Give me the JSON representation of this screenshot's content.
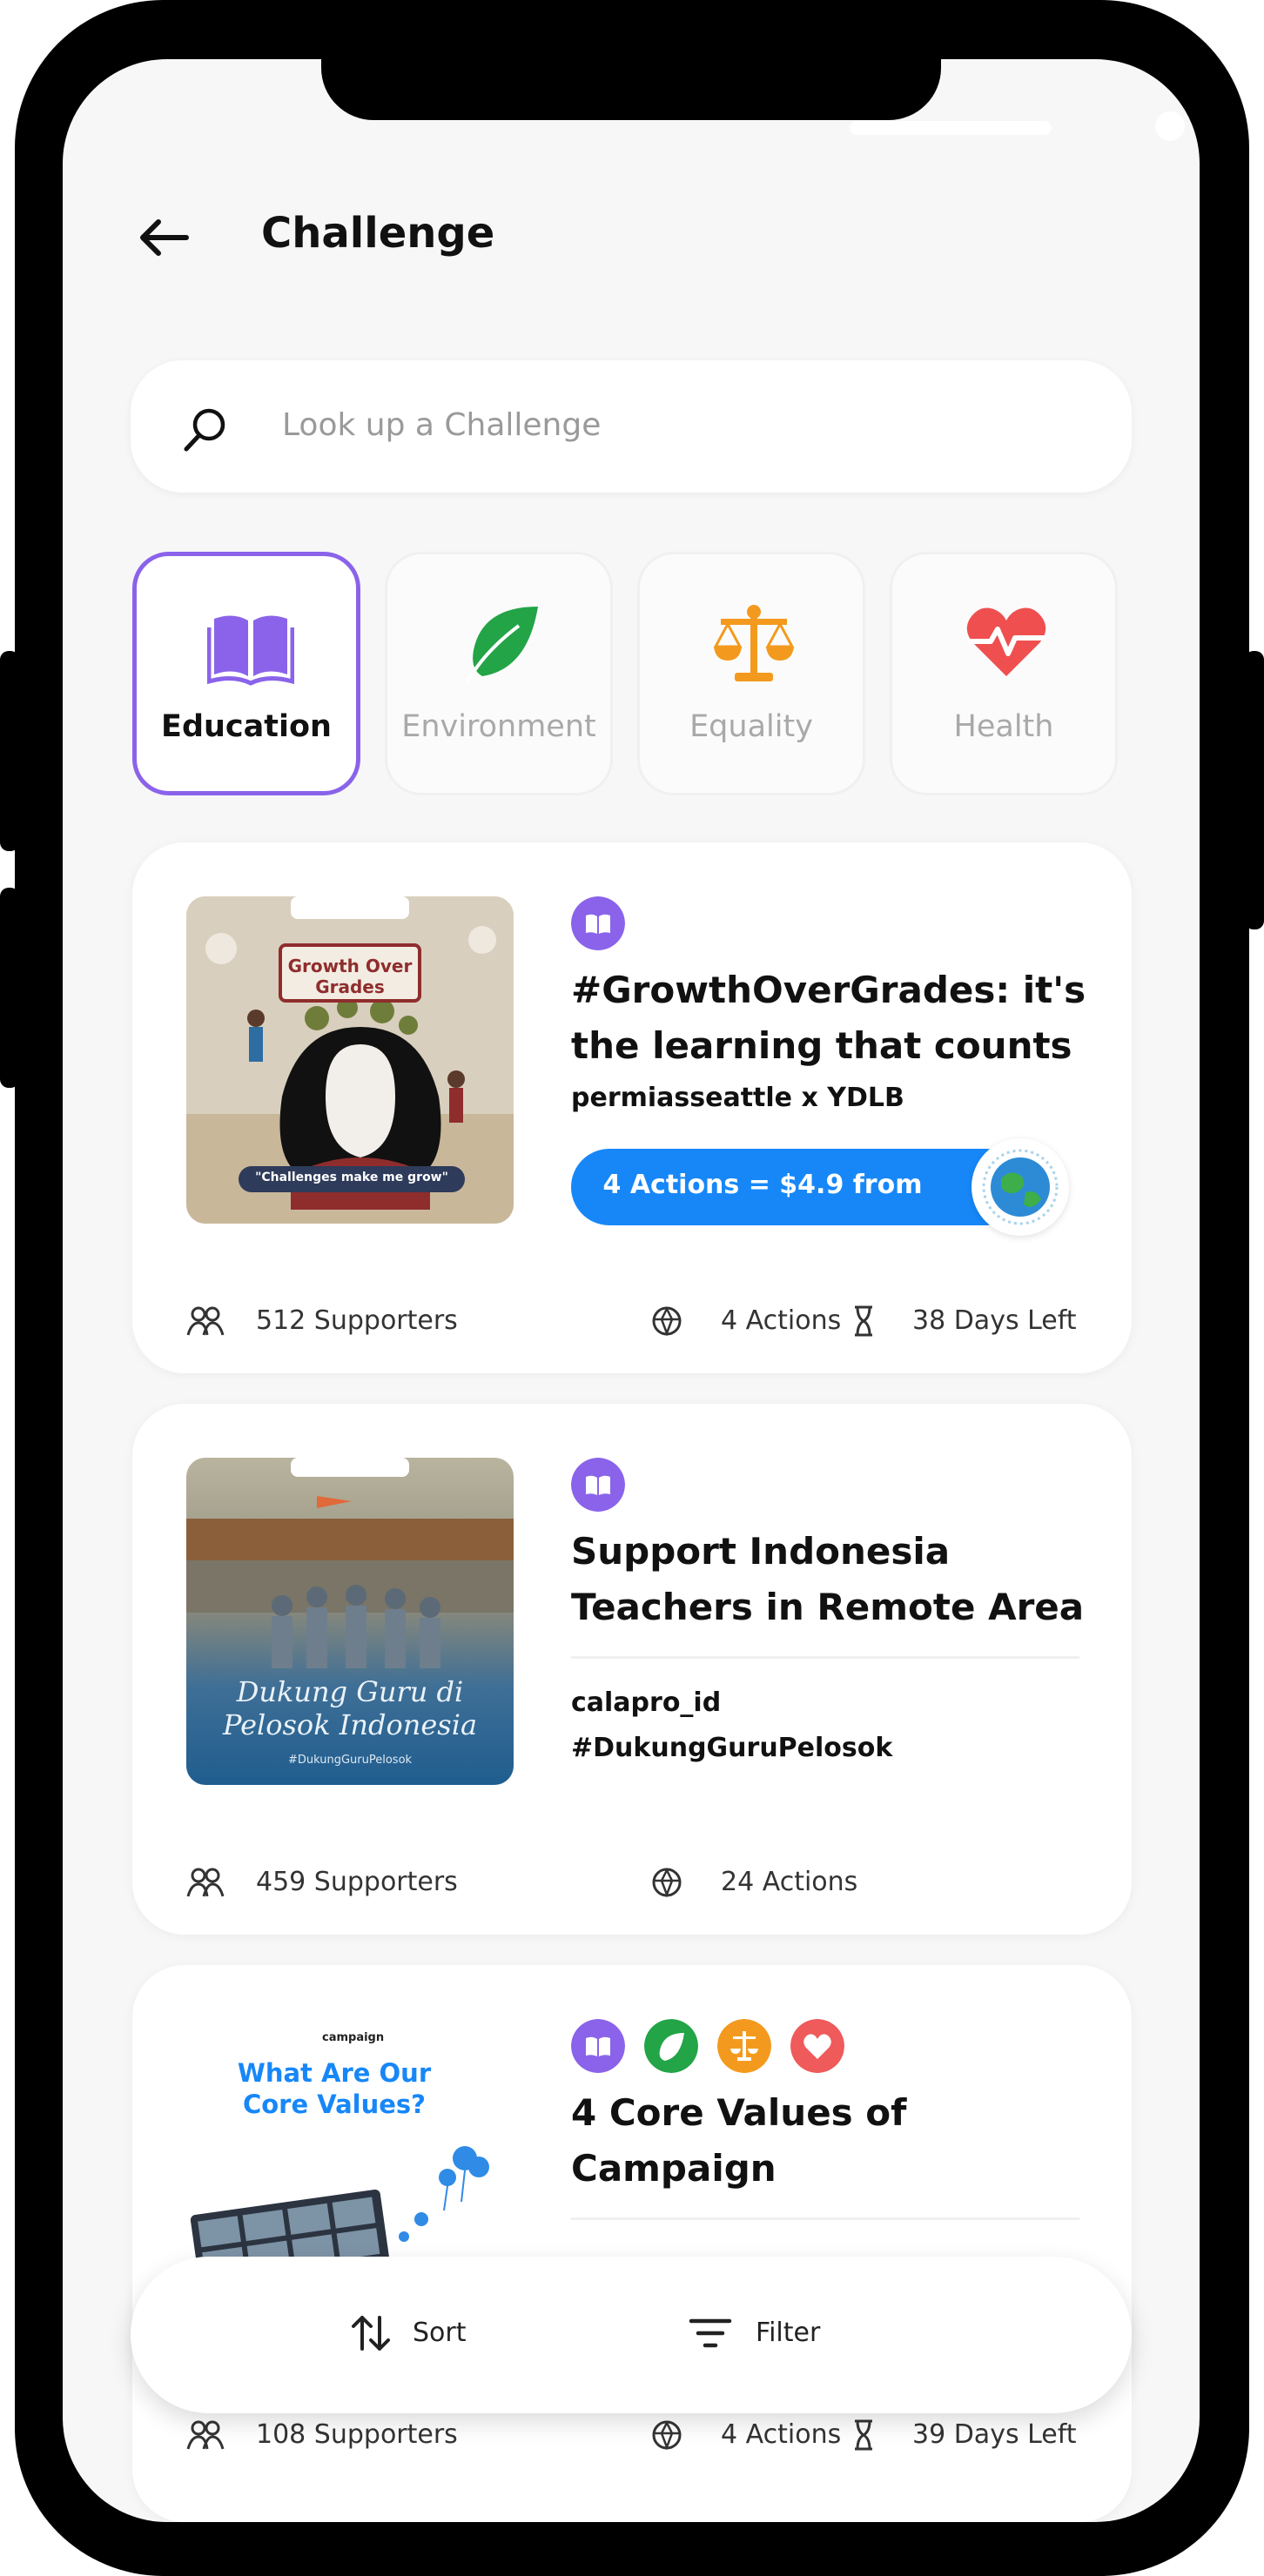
{
  "header": {
    "title": "Challenge"
  },
  "search": {
    "placeholder": "Look up a Challenge"
  },
  "categories": [
    {
      "label": "Education",
      "icon": "book-icon",
      "color": "#8a63ea",
      "active": true
    },
    {
      "label": "Environment",
      "icon": "leaf-icon",
      "color": "#22a447",
      "active": false
    },
    {
      "label": "Equality",
      "icon": "scales-icon",
      "color": "#f39a1e",
      "active": false
    },
    {
      "label": "Health",
      "icon": "heart-pulse-icon",
      "color": "#ef4f4f",
      "active": false
    }
  ],
  "challenges": [
    {
      "thumb_title": "Growth Over Grades",
      "thumb_caption": "\"Challenges make me grow\"",
      "title_line1": "#GrowthOverGrades: it's",
      "title_line2": "the learning that counts",
      "organizer": "permiasseattle x YDLB",
      "cta": "4 Actions = $4.9 from",
      "supporters": "512 Supporters",
      "actions": "4 Actions",
      "days_left": "38 Days Left"
    },
    {
      "thumb_title": "Dukung Guru di Pelosok Indonesia",
      "thumb_caption": "#DukungGuruPelosok",
      "title_line1": "Support Indonesia",
      "title_line2": "Teachers in Remote Area",
      "organizer": "calapro_id",
      "hashtag": "#DukungGuruPelosok",
      "supporters": "459 Supporters",
      "actions": "24 Actions"
    },
    {
      "thumb_brand": "campaign",
      "thumb_title_line1": "What Are Our",
      "thumb_title_line2": "Core Values?",
      "title_line1": "4 Core Values of",
      "title_line2": "Campaign",
      "supporters": "108 Supporters",
      "actions": "4 Actions",
      "days_left": "39 Days Left"
    }
  ],
  "bottom_bar": {
    "sort_label": "Sort",
    "filter_label": "Filter"
  },
  "colors": {
    "accent": "#8a63ea",
    "cta_blue": "#1787f8",
    "background": "#f7f7f8"
  }
}
